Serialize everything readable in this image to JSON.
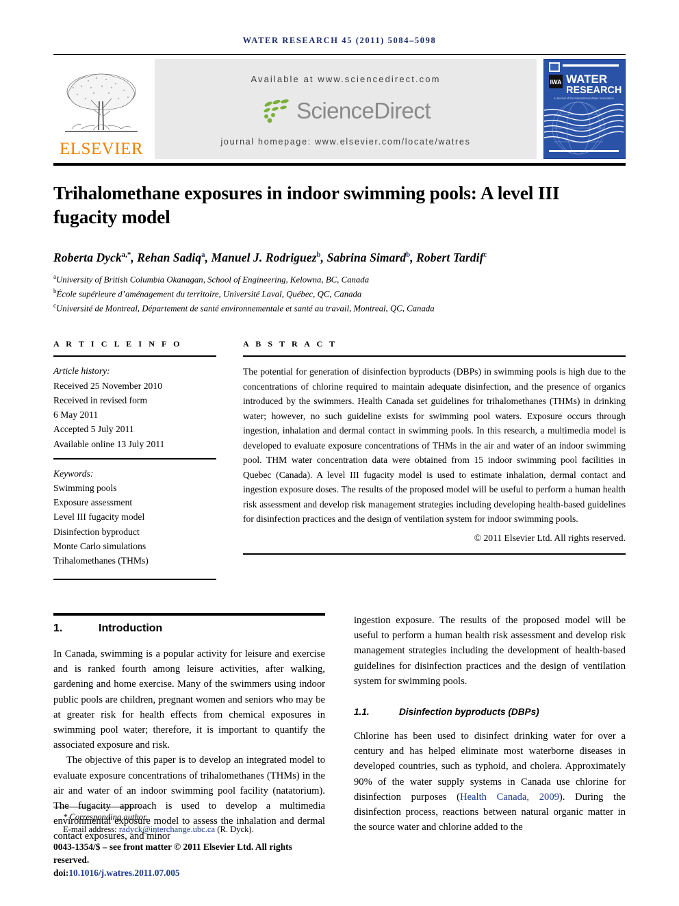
{
  "running_head": "WATER RESEARCH 45 (2011) 5084–5098",
  "banner": {
    "publisher_name": "ELSEVIER",
    "available_at": "Available at www.sciencedirect.com",
    "sciencedirect_word": "ScienceDirect",
    "journal_homepage": "journal homepage: www.elsevier.com/locate/watres",
    "cover": {
      "title_line1": "WATER",
      "title_line2": "RESEARCH",
      "subtitle": "A Journal of the International Water Association",
      "society_mark": "IWA",
      "background_color": "#2a53a8"
    },
    "colors": {
      "elsevier_orange": "#f08000",
      "sciencedirect_gray": "#8a8a8a",
      "sciencedirect_green": "#7bb03b",
      "strip_gray": "#e9e9e9"
    }
  },
  "article": {
    "title": "Trihalomethane exposures in indoor swimming pools: A level III fugacity model",
    "authors": [
      {
        "name": "Roberta Dyck",
        "marks": "a,*"
      },
      {
        "name": "Rehan Sadiq",
        "marks": "a"
      },
      {
        "name": "Manuel J. Rodriguez",
        "marks": "b"
      },
      {
        "name": "Sabrina Simard",
        "marks": "b"
      },
      {
        "name": "Robert Tardif",
        "marks": "c"
      }
    ],
    "affiliations": [
      {
        "mark": "a",
        "text": "University of British Columbia Okanagan, School of Engineering, Kelowna, BC, Canada"
      },
      {
        "mark": "b",
        "text": "École supérieure d’aménagement du territoire, Université Laval, Québec, QC, Canada"
      },
      {
        "mark": "c",
        "text": "Université de Montreal, Département de santé environnementale et santé au travail, Montreal, QC, Canada"
      }
    ]
  },
  "article_info": {
    "heading": "A R T I C L E    I N F O",
    "history_label": "Article history:",
    "history": [
      "Received 25 November 2010",
      "Received in revised form",
      "6 May 2011",
      "Accepted 5 July 2011",
      "Available online 13 July 2011"
    ],
    "keywords_label": "Keywords:",
    "keywords": [
      "Swimming pools",
      "Exposure assessment",
      "Level III fugacity model",
      "Disinfection byproduct",
      "Monte Carlo simulations",
      "Trihalomethanes (THMs)"
    ]
  },
  "abstract": {
    "heading": "A B S T R A C T",
    "text": "The potential for generation of disinfection byproducts (DBPs) in swimming pools is high due to the concentrations of chlorine required to maintain adequate disinfection, and the presence of organics introduced by the swimmers. Health Canada set guidelines for trihalomethanes (THMs) in drinking water; however, no such guideline exists for swimming pool waters. Exposure occurs through ingestion, inhalation and dermal contact in swimming pools. In this research, a multimedia model is developed to evaluate exposure concentrations of THMs in the air and water of an indoor swimming pool. THM water concentration data were obtained from 15 indoor swimming pool facilities in Quebec (Canada). A level III fugacity model is used to estimate inhalation, dermal contact and ingestion exposure doses. The results of the proposed model will be useful to perform a human health risk assessment and develop risk management strategies including developing health-based guidelines for disinfection practices and the design of ventilation system for indoor swimming pools.",
    "copyright": "© 2011 Elsevier Ltd. All rights reserved."
  },
  "body": {
    "section1": {
      "number": "1.",
      "title": "Introduction",
      "para1": "In Canada, swimming is a popular activity for leisure and exercise and is ranked fourth among leisure activities, after walking, gardening and home exercise. Many of the swimmers using indoor public pools are children, pregnant women and seniors who may be at greater risk for health effects from chemical exposures in swimming pool water; therefore, it is important to quantify the associated exposure and risk.",
      "para2": "The objective of this paper is to develop an integrated model to evaluate exposure concentrations of trihalomethanes (THMs) in the air and water of an indoor swimming pool facility (natatorium). The fugacity approach is used to develop a multimedia environmental exposure model to assess the inhalation and dermal contact exposures, and minor",
      "para2_cont": "ingestion exposure. The results of the proposed model will be useful to perform a human health risk assessment and develop risk management strategies including the development of health-based guidelines for disinfection practices and the design of ventilation system for swimming pools."
    },
    "subsection11": {
      "number": "1.1.",
      "title": "Disinfection byproducts (DBPs)",
      "para_before_cite": "Chlorine has been used to disinfect drinking water for over a century and has helped eliminate most waterborne diseases in developed countries, such as typhoid, and cholera. Approximately 90% of the water supply systems in Canada use chlorine for disinfection purposes (",
      "citation": "Health Canada, 2009",
      "para_after_cite": "). During the disinfection process, reactions between natural organic matter in the source water and chlorine added to the"
    }
  },
  "footnote": {
    "corresponding": "* Corresponding author.",
    "email_label": "E-mail address:",
    "email": "radyck@interchange.ubc.ca",
    "email_suffix": "(R. Dyck).",
    "issn_line": "0043-1354/$ – see front matter © 2011 Elsevier Ltd. All rights reserved.",
    "doi_label": "doi:",
    "doi": "10.1016/j.watres.2011.07.005"
  }
}
